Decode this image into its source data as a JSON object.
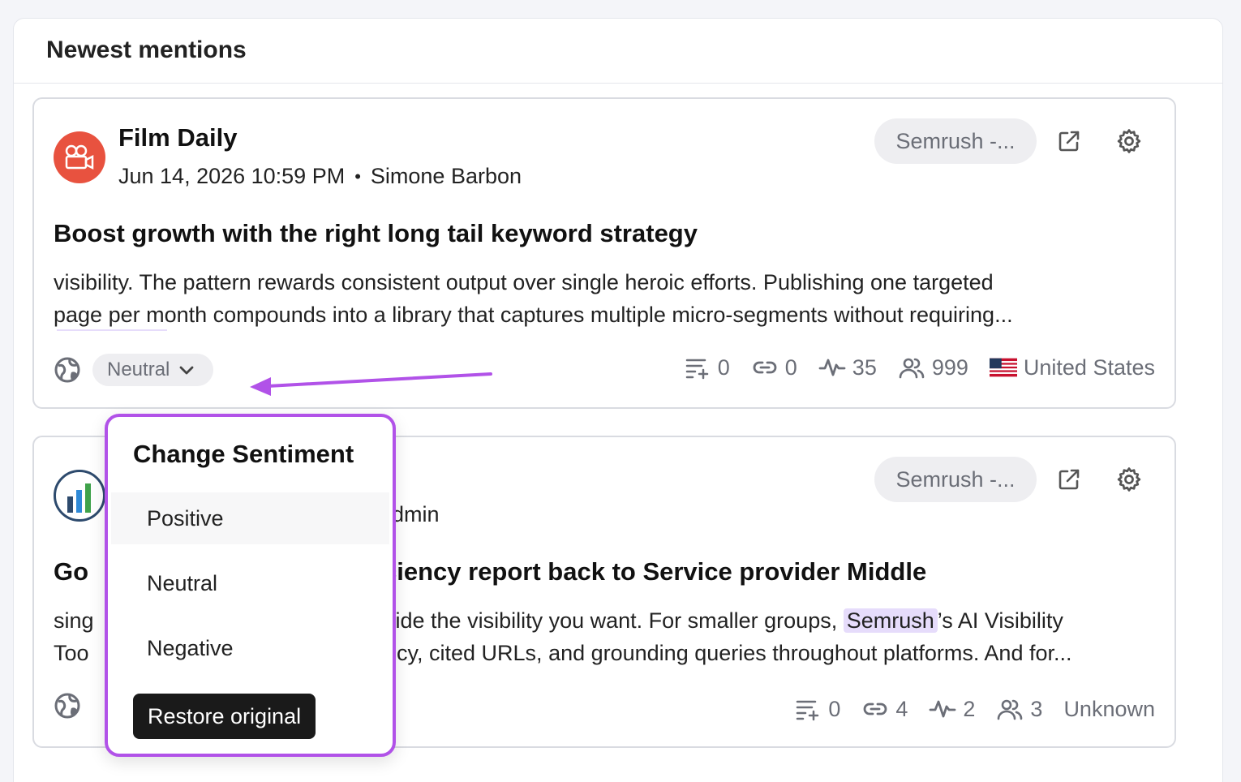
{
  "panel": {
    "title": "Newest mentions"
  },
  "mentions": [
    {
      "source": "Film Daily",
      "date": "Jun 14, 2026 10:59 PM",
      "author": "Simone Barbon",
      "project": "Semrush -...",
      "title": "Boost growth with the right long tail keyword strategy",
      "body_line1": "visibility. The pattern rewards consistent output over single heroic efforts. Publishing one targeted",
      "body_line2": "page per month compounds into a library that captures multiple micro-segments without requiring...",
      "sentiment": "Neutral",
      "stats": {
        "mentions": "0",
        "links": "0",
        "activity": "35",
        "reach": "999"
      },
      "country": "United States"
    },
    {
      "source": "",
      "author": "admin",
      "project": "Semrush -...",
      "title_start": "Go",
      "title_end": "ciency report back to Service provider Middle",
      "body_line1_start": "sing",
      "body_line1_end": "vide the visibility you want. For smaller groups,",
      "highlight": "Semrush",
      "body_line1_tail": "’s AI Visibility",
      "body_line2_start": "Too",
      "body_line2_end": "ncy, cited URLs, and grounding queries throughout platforms. And for...",
      "stats": {
        "mentions": "0",
        "links": "4",
        "activity": "2",
        "reach": "3"
      },
      "country": "Unknown"
    }
  ],
  "dropdown": {
    "title": "Change Sentiment",
    "options": [
      "Positive",
      "Neutral",
      "Negative"
    ],
    "restore_label": "Restore original"
  },
  "colors": {
    "accent": "#b152e8",
    "highlight": "#e6dcfb",
    "avatar_film": "#e8523f"
  }
}
